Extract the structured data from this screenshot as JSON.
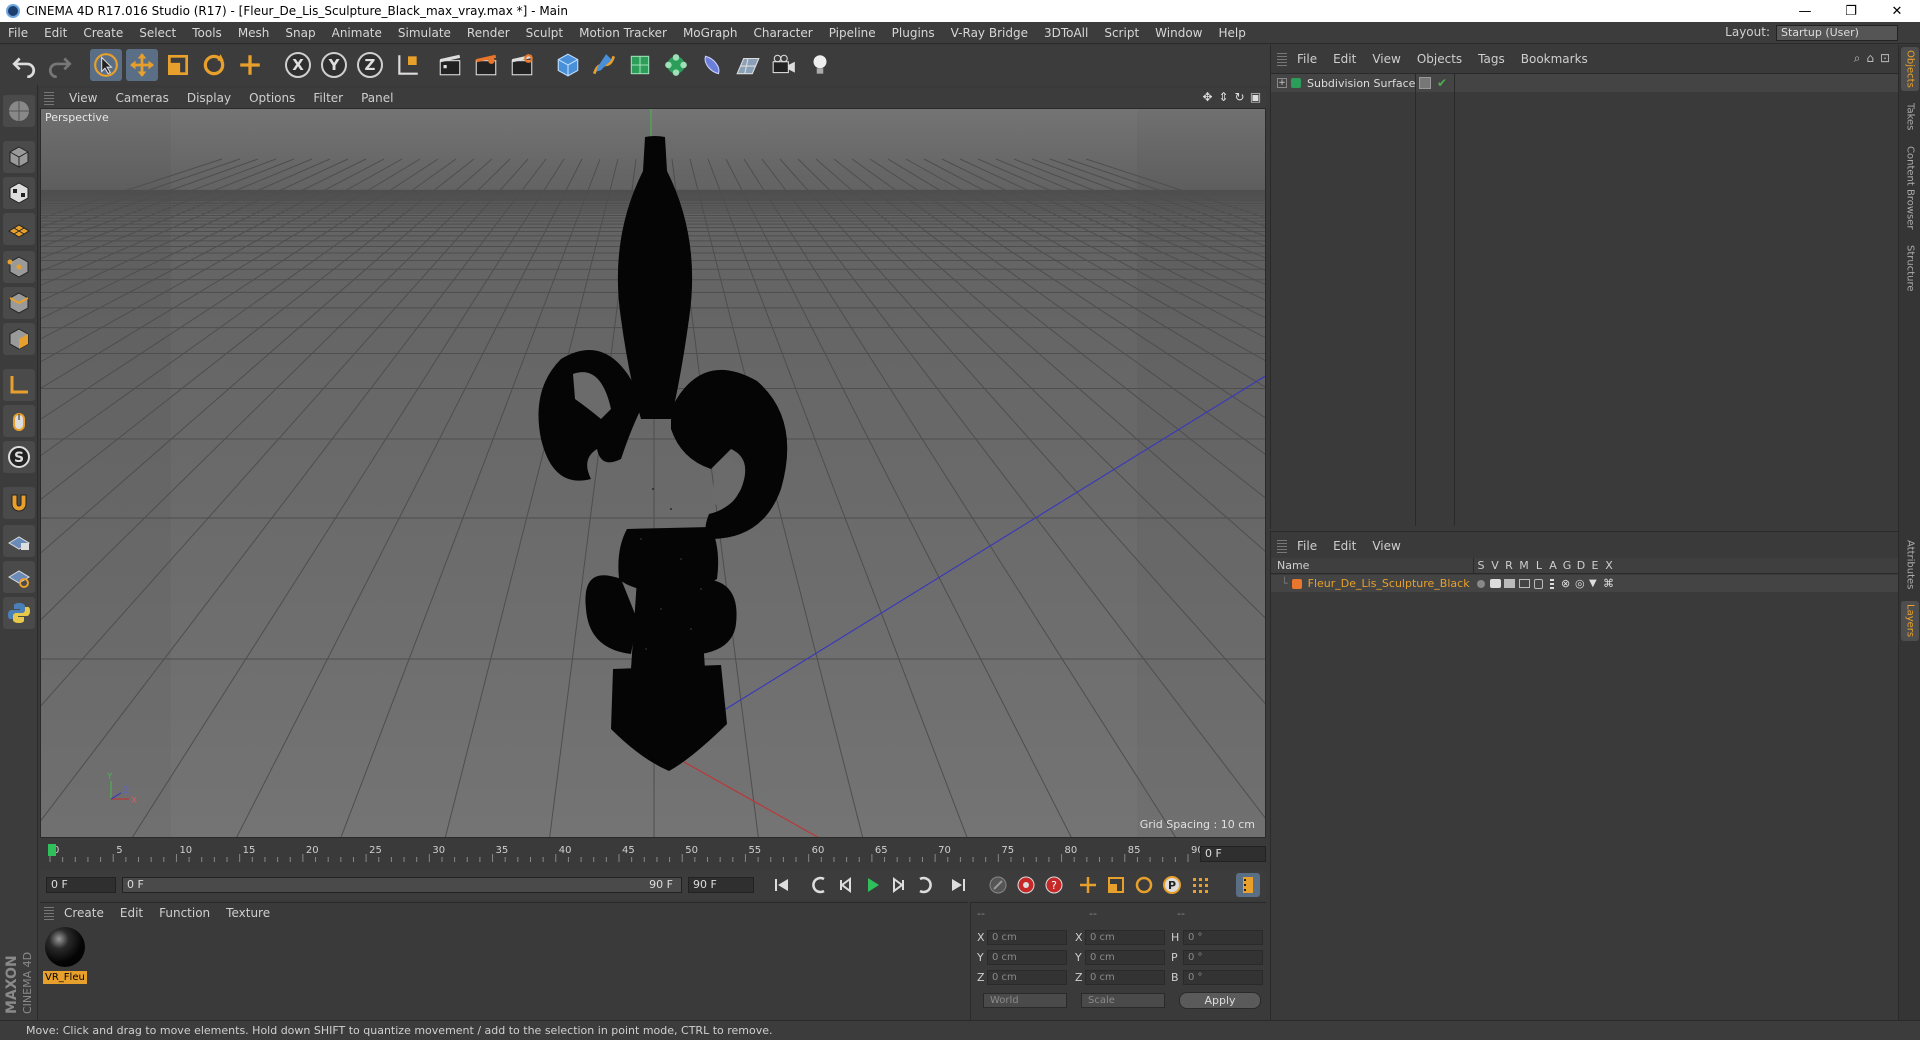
{
  "window": {
    "title": "CINEMA 4D R17.016 Studio (R17) - [Fleur_De_Lis_Sculpture_Black_max_vray.max *] - Main",
    "minimize": "—",
    "restore": "❐",
    "close": "✕"
  },
  "menubar": {
    "items": [
      "File",
      "Edit",
      "Create",
      "Select",
      "Tools",
      "Mesh",
      "Snap",
      "Animate",
      "Simulate",
      "Render",
      "Sculpt",
      "Motion Tracker",
      "MoGraph",
      "Character",
      "Pipeline",
      "Plugins",
      "V-Ray Bridge",
      "3DToAll",
      "Script",
      "Window",
      "Help"
    ],
    "layout_label": "Layout:",
    "layout_value": "Startup (User)"
  },
  "toolbar": {
    "axis_x": "X",
    "axis_y": "Y",
    "axis_z": "Z"
  },
  "viewport": {
    "menu": [
      "View",
      "Cameras",
      "Display",
      "Options",
      "Filter",
      "Panel"
    ],
    "label": "Perspective",
    "grid_spacing": "Grid Spacing : 10 cm",
    "axis_y": "Y",
    "axis_z": "Z",
    "axis_x": "X"
  },
  "timeline": {
    "ticks": [
      "0",
      "5",
      "10",
      "15",
      "20",
      "25",
      "30",
      "35",
      "40",
      "45",
      "50",
      "55",
      "60",
      "65",
      "70",
      "75",
      "80",
      "85",
      "90"
    ],
    "current_frame_right": "0 F",
    "start_frame": "0 F",
    "range_start": "0 F",
    "range_end": "90 F",
    "end_frame": "90 F",
    "playhead_fraction": 0.0
  },
  "materials": {
    "menu": [
      "Create",
      "Edit",
      "Function",
      "Texture"
    ],
    "items": [
      {
        "name": "VR_Fleu"
      }
    ]
  },
  "coordinates": {
    "header": [
      "--",
      "--",
      "--"
    ],
    "pos_x_label": "X",
    "pos_x": "0 cm",
    "pos_y_label": "Y",
    "pos_y": "0 cm",
    "pos_z_label": "Z",
    "pos_z": "0 cm",
    "size_x_label": "X",
    "size_x": "0 cm",
    "size_y_label": "Y",
    "size_y": "0 cm",
    "size_z_label": "Z",
    "size_z": "0 cm",
    "rot_h_label": "H",
    "rot_h": "0 °",
    "rot_p_label": "P",
    "rot_p": "0 °",
    "rot_b_label": "B",
    "rot_b": "0 °",
    "mode_world": "World",
    "mode_scale": "Scale",
    "apply": "Apply"
  },
  "objects": {
    "menu": [
      "File",
      "Edit",
      "View",
      "Objects",
      "Tags",
      "Bookmarks"
    ],
    "items": [
      {
        "name": "Subdivision Surface"
      }
    ]
  },
  "layers": {
    "menu": [
      "File",
      "Edit",
      "View"
    ],
    "columns": {
      "name": "Name",
      "flags": [
        "S",
        "V",
        "R",
        "M",
        "L",
        "A",
        "G",
        "D",
        "E",
        "X"
      ]
    },
    "items": [
      {
        "name": "Fleur_De_Lis_Sculpture_Black",
        "color": "#e8762c"
      }
    ]
  },
  "side_tabs": [
    "Objects",
    "Takes",
    "Content Browser",
    "Structure",
    "Attributes",
    "Layers"
  ],
  "status": {
    "text": "Move: Click and drag to move elements. Hold down SHIFT to quantize movement / add to the selection in point mode, CTRL to remove."
  },
  "branding": {
    "maxon": "MAXON",
    "cinema": "CINEMA 4D"
  },
  "colors": {
    "accent_orange": "#e8a02c",
    "active_blue": "#5a6e86",
    "panel_bg": "#3a3a3a"
  }
}
